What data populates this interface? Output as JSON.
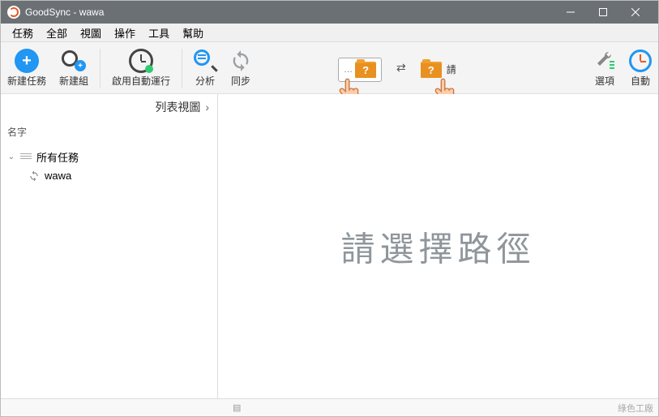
{
  "titlebar": {
    "title": "GoodSync - wawa"
  },
  "menu": {
    "items": [
      "任務",
      "全部",
      "視圖",
      "操作",
      "工具",
      "幫助"
    ]
  },
  "toolbar": {
    "new_task": "新建任務",
    "new_group": "新建組",
    "enable_auto": "啟用自動運行",
    "analyze": "分析",
    "sync": "同步",
    "left_hint": "",
    "right_hint": "請",
    "options": "選項",
    "auto": "自動"
  },
  "sidebar": {
    "list_view": "列表視圖",
    "name_header": "名字",
    "root": "所有任務",
    "job": "wawa"
  },
  "main": {
    "placeholder": "請選擇路徑"
  },
  "status": {
    "brand": "綠色工廠"
  }
}
